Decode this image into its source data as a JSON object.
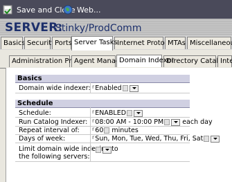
{
  "toolbar": {
    "save_close_label": "Save and Close",
    "web_label": "Web..."
  },
  "header": {
    "server_label": "SERVER:",
    "server_name": "Stinky/ProdComm"
  },
  "tabs": [
    "Basics",
    "Security",
    "Ports",
    "Server Tasks",
    "Internet Protocols",
    "MTAs",
    "Miscellaneous"
  ],
  "active_tab": "Server Tasks",
  "subtabs": [
    "Administration Process",
    "Agent Manager",
    "Domain Indexer",
    "Directory Cataloger",
    "Inter"
  ],
  "active_subtab": "Domain Indexer",
  "basics": {
    "title": "Basics",
    "domain_indexer_label": "Domain wide indexer:",
    "domain_indexer_value": "Enabled"
  },
  "schedule": {
    "title": "Schedule",
    "schedule_label": "Schedule:",
    "schedule_value": "ENABLED",
    "run_label": "Run Catalog Indexer:",
    "run_value": "08:00 AM - 10:00 PM",
    "run_suffix": "each day",
    "repeat_label": "Repeat interval of:",
    "repeat_value": "60",
    "repeat_suffix": "minutes",
    "days_label": "Days of week:",
    "days_value": "Sun, Mon, Tue, Wed, Thu, Fri, Sat",
    "limit_label_line1": "Limit domain wide indexing to",
    "limit_label_line2": "the following servers:"
  },
  "colors": {
    "toolbar_bg": "#4a4a5a",
    "header_text": "#1c2f6b",
    "section_bg": "#d0d0e2"
  }
}
